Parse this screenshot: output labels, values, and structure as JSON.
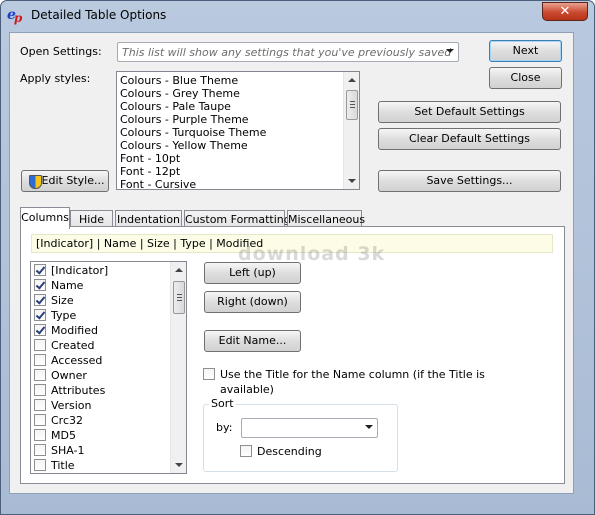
{
  "window": {
    "title": "Detailed Table Options",
    "close_glyph": "✕",
    "app_icon_main": "e",
    "app_icon_sub": "p"
  },
  "open_settings": {
    "label": "Open Settings:",
    "placeholder": "This list will show any settings that you've previously saved"
  },
  "apply_styles": {
    "label": "Apply styles:",
    "items": [
      "Colours - Blue Theme",
      "Colours - Grey Theme",
      "Colours - Pale Taupe",
      "Colours - Purple Theme",
      "Colours - Turquoise Theme",
      "Colours - Yellow Theme",
      "Font - 10pt",
      "Font - 12pt",
      "Font - Cursive"
    ]
  },
  "buttons": {
    "next": "Next",
    "close": "Close",
    "set_default": "Set Default Settings",
    "clear_default": "Clear Default Settings",
    "save_settings": "Save Settings...",
    "edit_style": "Edit Style..."
  },
  "tabs": [
    "Columns",
    "Hide",
    "Indentation",
    "Custom Formatting",
    "Miscellaneous"
  ],
  "columns_tab": {
    "summary": "[Indicator] | Name | Size | Type | Modified",
    "columns": [
      {
        "label": "[Indicator]",
        "checked": true
      },
      {
        "label": "Name",
        "checked": true
      },
      {
        "label": "Size",
        "checked": true
      },
      {
        "label": "Type",
        "checked": true
      },
      {
        "label": "Modified",
        "checked": true
      },
      {
        "label": "Created",
        "checked": false
      },
      {
        "label": "Accessed",
        "checked": false
      },
      {
        "label": "Owner",
        "checked": false
      },
      {
        "label": "Attributes",
        "checked": false
      },
      {
        "label": "Version",
        "checked": false
      },
      {
        "label": "Crc32",
        "checked": false
      },
      {
        "label": "MD5",
        "checked": false
      },
      {
        "label": "SHA-1",
        "checked": false
      },
      {
        "label": "Title",
        "checked": false
      }
    ],
    "left_up": "Left (up)",
    "right_down": "Right (down)",
    "edit_name": "Edit Name...",
    "use_title": "Use the Title for the Name column (if the Title is available)",
    "sort": {
      "legend": "Sort",
      "by_label": "by:",
      "by_value": "",
      "descending": "Descending"
    }
  },
  "watermark": "download 3k",
  "colors": {
    "title_bar": "#b9c9de",
    "client_bg": "#f0f0f0",
    "summary_bg": "#fdfde7",
    "close_red": "#c94a2f"
  }
}
